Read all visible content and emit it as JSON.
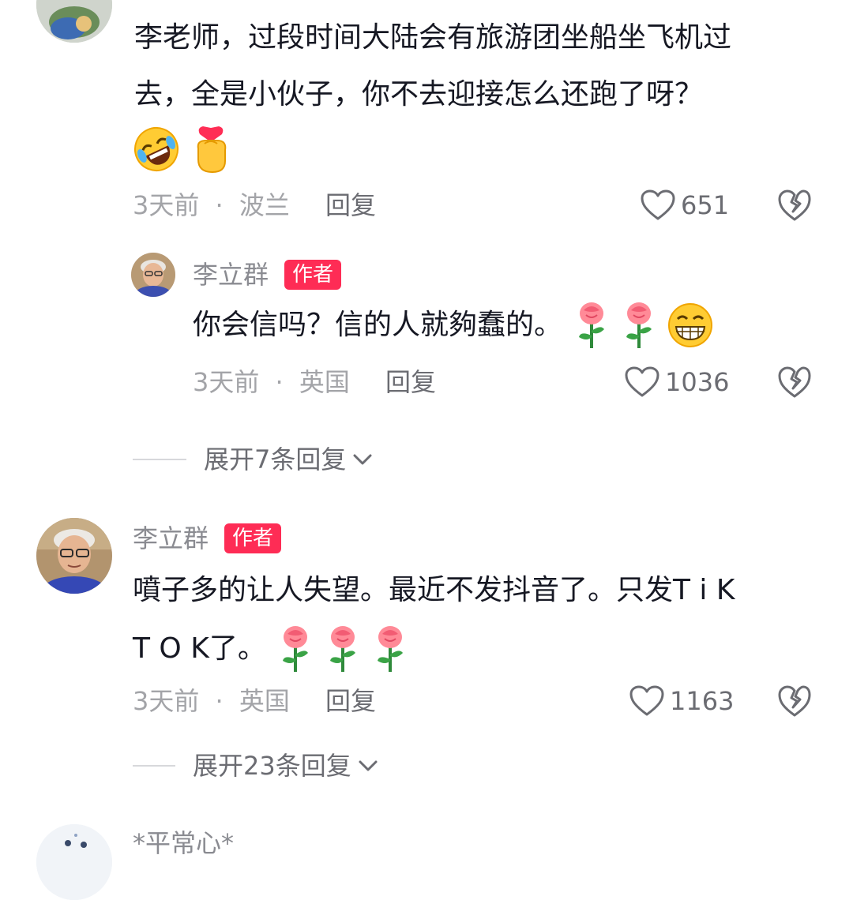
{
  "comments": [
    {
      "text_line1": "李老师，过段时间大陆会有旅游团坐船坐飞机过",
      "text_line2": "去，全是小伙子，你不去迎接怎么还跑了呀？",
      "emojis": [
        "rolling-laughing-emoji",
        "finger-heart-emoji"
      ],
      "time": "3天前",
      "location": "波兰",
      "reply_label": "回复",
      "likes": "651",
      "reply": {
        "username": "李立群",
        "badge": "作者",
        "text": "你会信吗？信的人就夠蠢的。",
        "emojis": [
          "rose-emoji",
          "rose-emoji",
          "grinning-emoji"
        ],
        "time": "3天前",
        "location": "英国",
        "reply_label": "回复",
        "likes": "1036"
      },
      "expand_label": "展开7条回复"
    },
    {
      "username": "李立群",
      "badge": "作者",
      "text_line1": "噴子多的让人失望。最近不发抖音了。只发T i K",
      "text_line2": "T O K了。",
      "emojis": [
        "rose-emoji",
        "rose-emoji",
        "rose-emoji"
      ],
      "time": "3天前",
      "location": "英国",
      "reply_label": "回复",
      "likes": "1163",
      "expand_label": "展开23条回复"
    },
    {
      "username": "*平常心*"
    }
  ],
  "separator": "·",
  "colors": {
    "author_badge": "#fe2c55",
    "text": "#161823",
    "meta": "#a3a4a8"
  }
}
